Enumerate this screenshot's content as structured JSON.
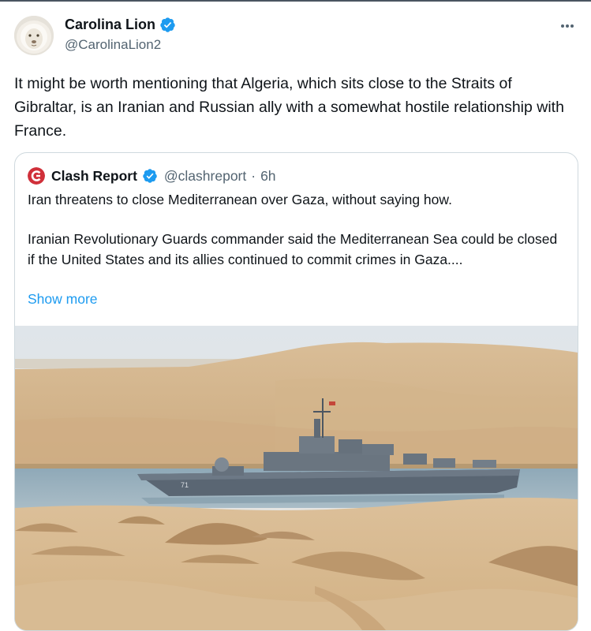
{
  "author": {
    "display_name": "Carolina Lion",
    "handle": "@CarolinaLion2",
    "avatar_icon": "lion-avatar",
    "verified_icon": "verified-badge-icon"
  },
  "menu_icon": "more-options-icon",
  "tweet": {
    "text": "It might be worth mentioning that Algeria, which sits close to the Straits of Gibraltar, is an Iranian and Russian ally with a somewhat hostile relationship with France."
  },
  "quote": {
    "display_name": "Clash Report",
    "handle": "@clashreport",
    "separator": "·",
    "time": "6h",
    "line1": "Iran threatens to close Mediterranean over Gaza, without saying how.",
    "paragraph": "Iranian Revolutionary Guards commander said the Mediterranean Sea could be closed if the United States and its allies continued to commit crimes in Gaza....",
    "show_more": "Show more",
    "logo_icon": "clash-report-logo",
    "media_description_icon": "warship-photo",
    "hull_number": "71"
  },
  "colors": {
    "verified_blue": "#1d9bf0",
    "link_blue": "#1d9bf0",
    "text": "#0f1419",
    "secondary_text": "#536471",
    "border": "#cfd9de",
    "clash_red": "#d0303a"
  }
}
